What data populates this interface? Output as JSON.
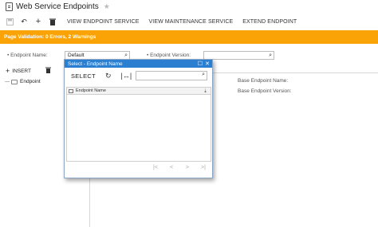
{
  "header": {
    "title": "Web Service Endpoints",
    "star": "★"
  },
  "toolbar": {
    "save_icon": "save-icon",
    "undo_icon": "undo-icon",
    "add_icon": "add-icon",
    "delete_icon": "delete-icon",
    "view_endpoint": "VIEW ENDPOINT SERVICE",
    "view_maintenance": "VIEW MAINTENANCE SERVICE",
    "extend_endpoint": "EXTEND ENDPOINT"
  },
  "validation": {
    "text": "Page Validation: 0 Errors, 2 Warnings",
    "color": "#f9a307"
  },
  "form": {
    "endpoint_name_label": "Endpoint Name:",
    "endpoint_name_value": "Default",
    "endpoint_version_label": "Endpoint Version:",
    "endpoint_version_value": ""
  },
  "left_pane": {
    "insert_label": "INSERT",
    "tree_item": "Endpoint"
  },
  "right_pane": {
    "base_name_label": "Base Endpoint Name:",
    "base_version_label": "Base Endpoint Version:"
  },
  "dialog": {
    "title": "Select - Endpoint Name",
    "select_label": "SELECT",
    "search_value": "",
    "column_header": "Endpoint Name",
    "pager": [
      "|<",
      "<",
      ">",
      ">|"
    ],
    "accent_color": "#2b7fd0"
  }
}
